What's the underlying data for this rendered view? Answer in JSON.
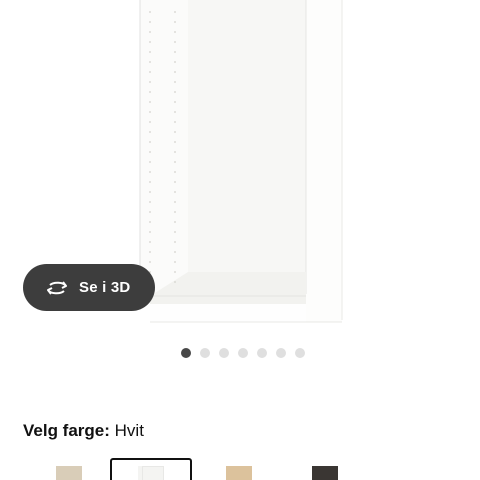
{
  "view3d": {
    "label": "Se i 3D",
    "icon": "rotate-3d-icon"
  },
  "carousel": {
    "count": 7,
    "active_index": 0
  },
  "color": {
    "label": "Velg farge:",
    "value": "Hvit"
  },
  "swatches": [
    {
      "name": "birch-effect",
      "color": "#d9cdb8",
      "selected": false
    },
    {
      "name": "white",
      "color": "#f4f4f2",
      "selected": true
    },
    {
      "name": "oak-effect",
      "color": "#dcc29c",
      "selected": false
    },
    {
      "name": "black-brown",
      "color": "#3a3633",
      "selected": false
    }
  ]
}
